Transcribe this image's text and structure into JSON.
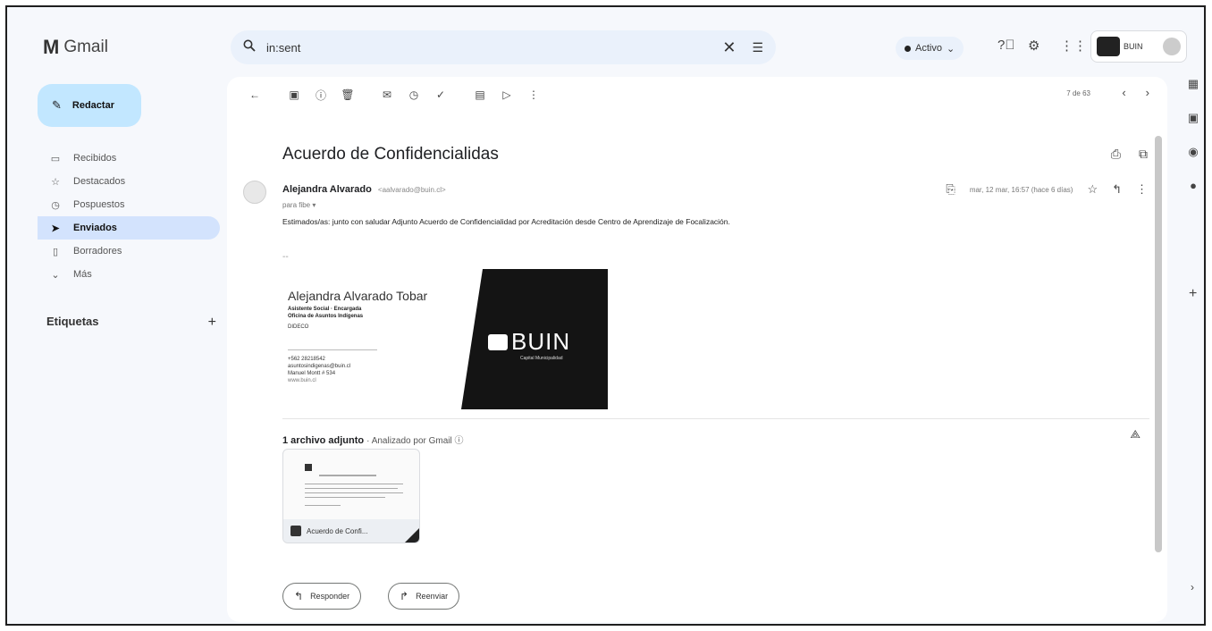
{
  "app": {
    "logo_mark": "M",
    "name": "Gmail"
  },
  "search": {
    "value": "in:sent",
    "clear_icon": "close-icon",
    "filter_icon": "tune-icon"
  },
  "status": {
    "label": "Activo"
  },
  "account": {
    "name": "BUIN"
  },
  "compose": {
    "label": "Redactar"
  },
  "nav": {
    "items": [
      {
        "label": "Recibidos",
        "icon": "inbox-icon",
        "selected": false
      },
      {
        "label": "Destacados",
        "icon": "star-icon",
        "selected": false
      },
      {
        "label": "Pospuestos",
        "icon": "clock-icon",
        "selected": false
      },
      {
        "label": "Enviados",
        "icon": "send-icon",
        "selected": true
      },
      {
        "label": "Borradores",
        "icon": "draft-icon",
        "selected": false
      },
      {
        "label": "Más",
        "icon": "chevron-down-icon",
        "selected": false
      }
    ]
  },
  "labels": {
    "title": "Etiquetas",
    "add": "+"
  },
  "pager": {
    "count": "7 de 63"
  },
  "email": {
    "subject": "Acuerdo de Confidencialidas",
    "sender_name": "Alejandra Alvarado",
    "sender_email": "<aalvarado@buin.cl>",
    "to": "para fibe ▾",
    "date": "mar, 12 mar, 16:57 (hace 6 días)",
    "body": "Estimados/as: junto con saludar Adjunto Acuerdo de Confidencialidad por Acreditación desde Centro de Aprendizaje de Focalización.",
    "separator": "--"
  },
  "signature": {
    "name": "Alejandra Alvarado Tobar",
    "role": "Asistente Social · Encargada",
    "office": "Oficina de Asuntos Indígenas",
    "dept": "DIDECO",
    "phone": "+562 28218542",
    "mail": "asuntosindigenas@buin.cl",
    "address": "Manuel Montt # 534",
    "web": "www.buin.cl",
    "brand": "BUIN",
    "brand_tag": "Capital Municipalidad"
  },
  "attachments": {
    "header": "1 archivo adjunto",
    "scanned": "· Analizado por Gmail ⓘ",
    "file_name": "Acuerdo de Confi..."
  },
  "actions": {
    "reply": "Responder",
    "forward": "Reenviar"
  },
  "colors": {
    "compose_bg": "#c2e7ff",
    "selected_nav": "#d3e3fd",
    "search_bg": "#eaf1fb"
  }
}
